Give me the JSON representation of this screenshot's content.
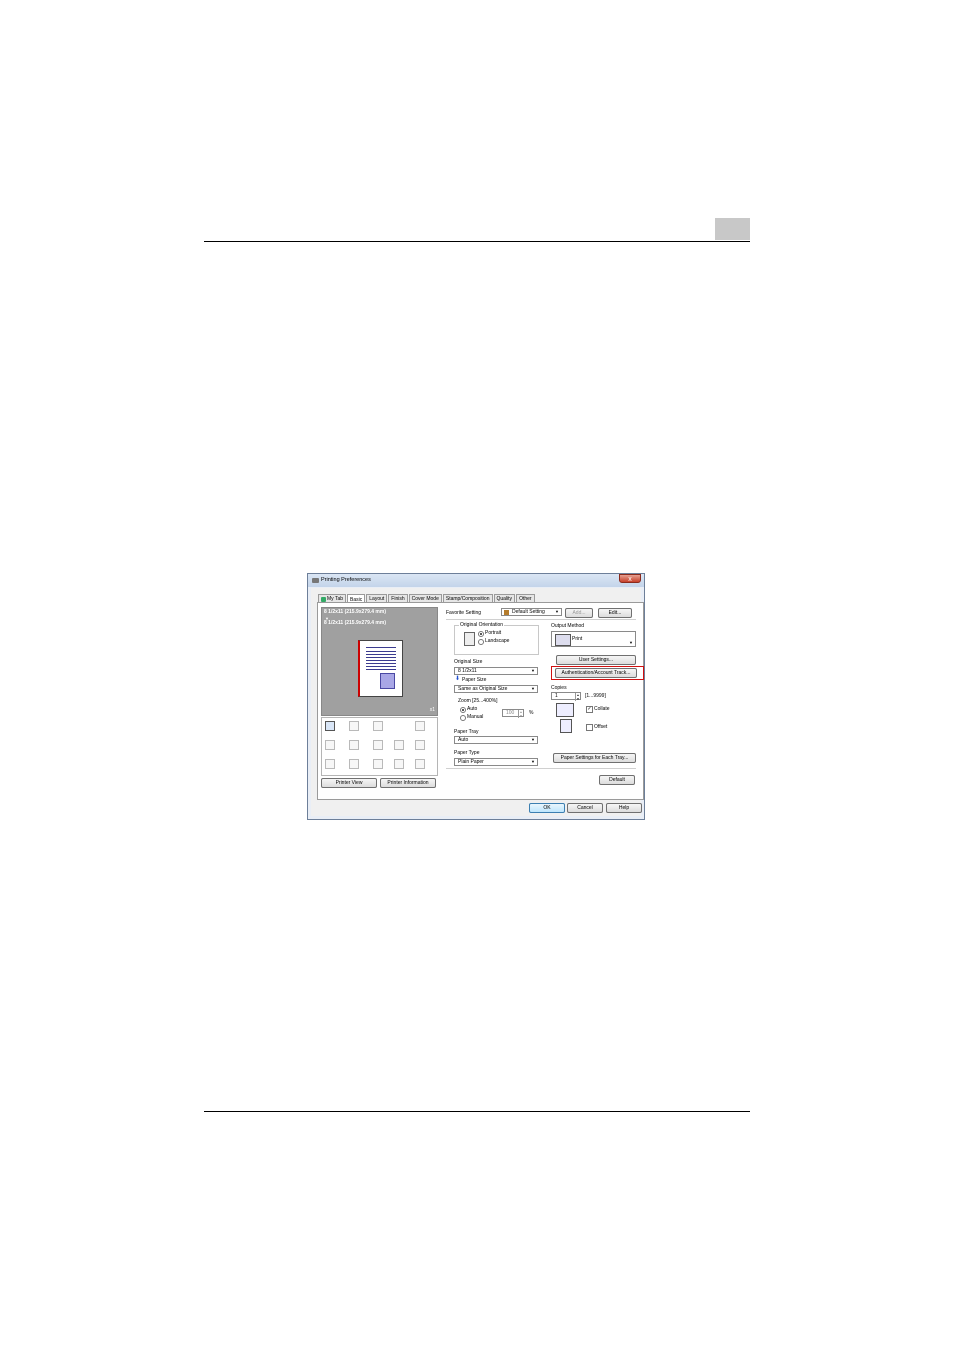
{
  "dialog": {
    "title": "Printing Preferences",
    "close_label": "x",
    "tabs": [
      "My Tab",
      "Basic",
      "Layout",
      "Finish",
      "Cover Mode",
      "Stamp/Composition",
      "Quality",
      "Other"
    ],
    "active_tab": "Basic"
  },
  "preview": {
    "original_size_text": "8 1/2x11 (215.9x279.4 mm)",
    "arrow": "▼",
    "paper_size_text": "8 1/2x11 (215.9x279.4 mm)",
    "copies_badge": "x1",
    "printer_view_label": "Printer View",
    "printer_information_label": "Printer Information"
  },
  "favorite": {
    "label": "Favorite Setting",
    "value": "Default Setting",
    "add_label": "Add...",
    "edit_label": "Edit..."
  },
  "orientation": {
    "label": "Original Orientation",
    "portrait_label": "Portrait",
    "landscape_label": "Landscape",
    "selected": "Portrait"
  },
  "original_size": {
    "label": "Original Size",
    "value": "8 1/2x11"
  },
  "paper_size": {
    "label": "Paper Size",
    "value": "Same as Original Size"
  },
  "zoom": {
    "label": "Zoom [25...400%]",
    "auto_label": "Auto",
    "manual_label": "Manual",
    "value": "100",
    "unit": "%",
    "selected": "Auto"
  },
  "paper_tray": {
    "label": "Paper Tray",
    "value": "Auto"
  },
  "paper_type": {
    "label": "Paper Type",
    "value": "Plain Paper"
  },
  "output_method": {
    "label": "Output Method",
    "value": "Print"
  },
  "user_settings_label": "User Settings...",
  "auth_button_label": "Authentication/Account Track...",
  "copies": {
    "label": "Copies",
    "value": "1",
    "range": "[1...9999]"
  },
  "collate": {
    "label": "Collate",
    "checked": true,
    "mark": "✓"
  },
  "offset": {
    "label": "Offset",
    "checked": false
  },
  "paper_settings_tray_label": "Paper Settings for Each Tray...",
  "default_label": "Default",
  "footer": {
    "ok_label": "OK",
    "cancel_label": "Cancel",
    "help_label": "Help"
  },
  "colors": {
    "highlight": "#d01010",
    "accent_blue": "#2050d0"
  }
}
